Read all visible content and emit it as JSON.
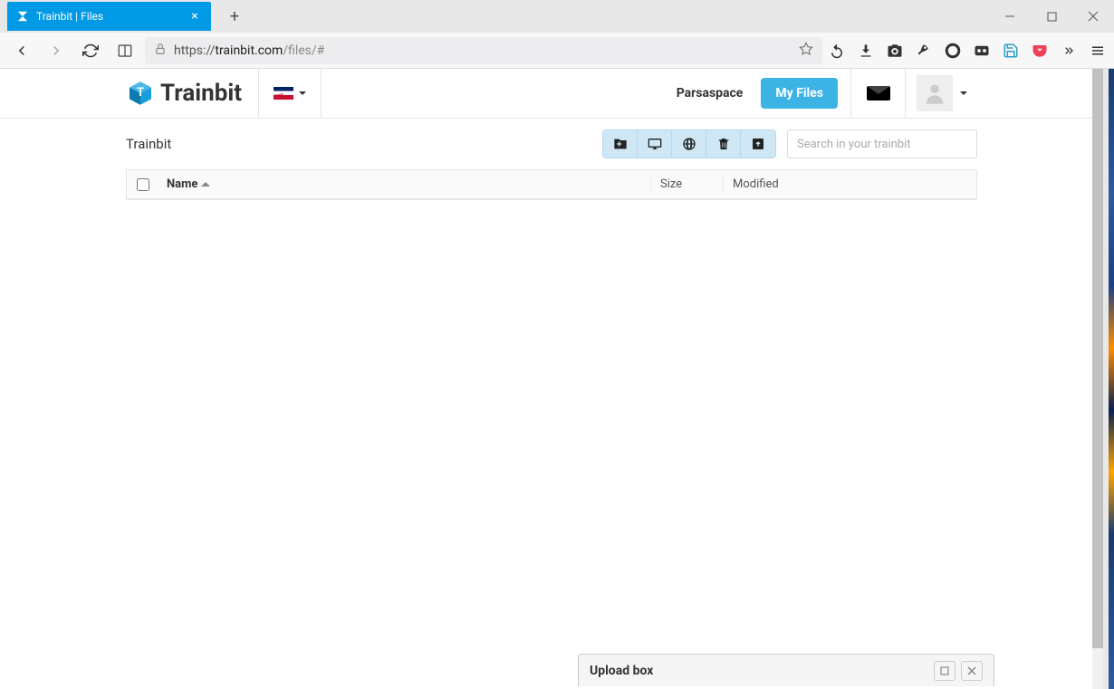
{
  "browser": {
    "tab_title": "Trainbit | Files",
    "url_scheme": "https://",
    "url_host": "trainbit.com",
    "url_path": "/files/#"
  },
  "topnav": {
    "logo_text": "Trainbit",
    "parsaspace": "Parsaspace",
    "my_files": "My Files"
  },
  "toolbar": {
    "breadcrumb": "Trainbit",
    "search_placeholder": "Search in your trainbit"
  },
  "table": {
    "col_name": "Name",
    "col_size": "Size",
    "col_modified": "Modified"
  },
  "upload_box": {
    "title": "Upload box"
  }
}
